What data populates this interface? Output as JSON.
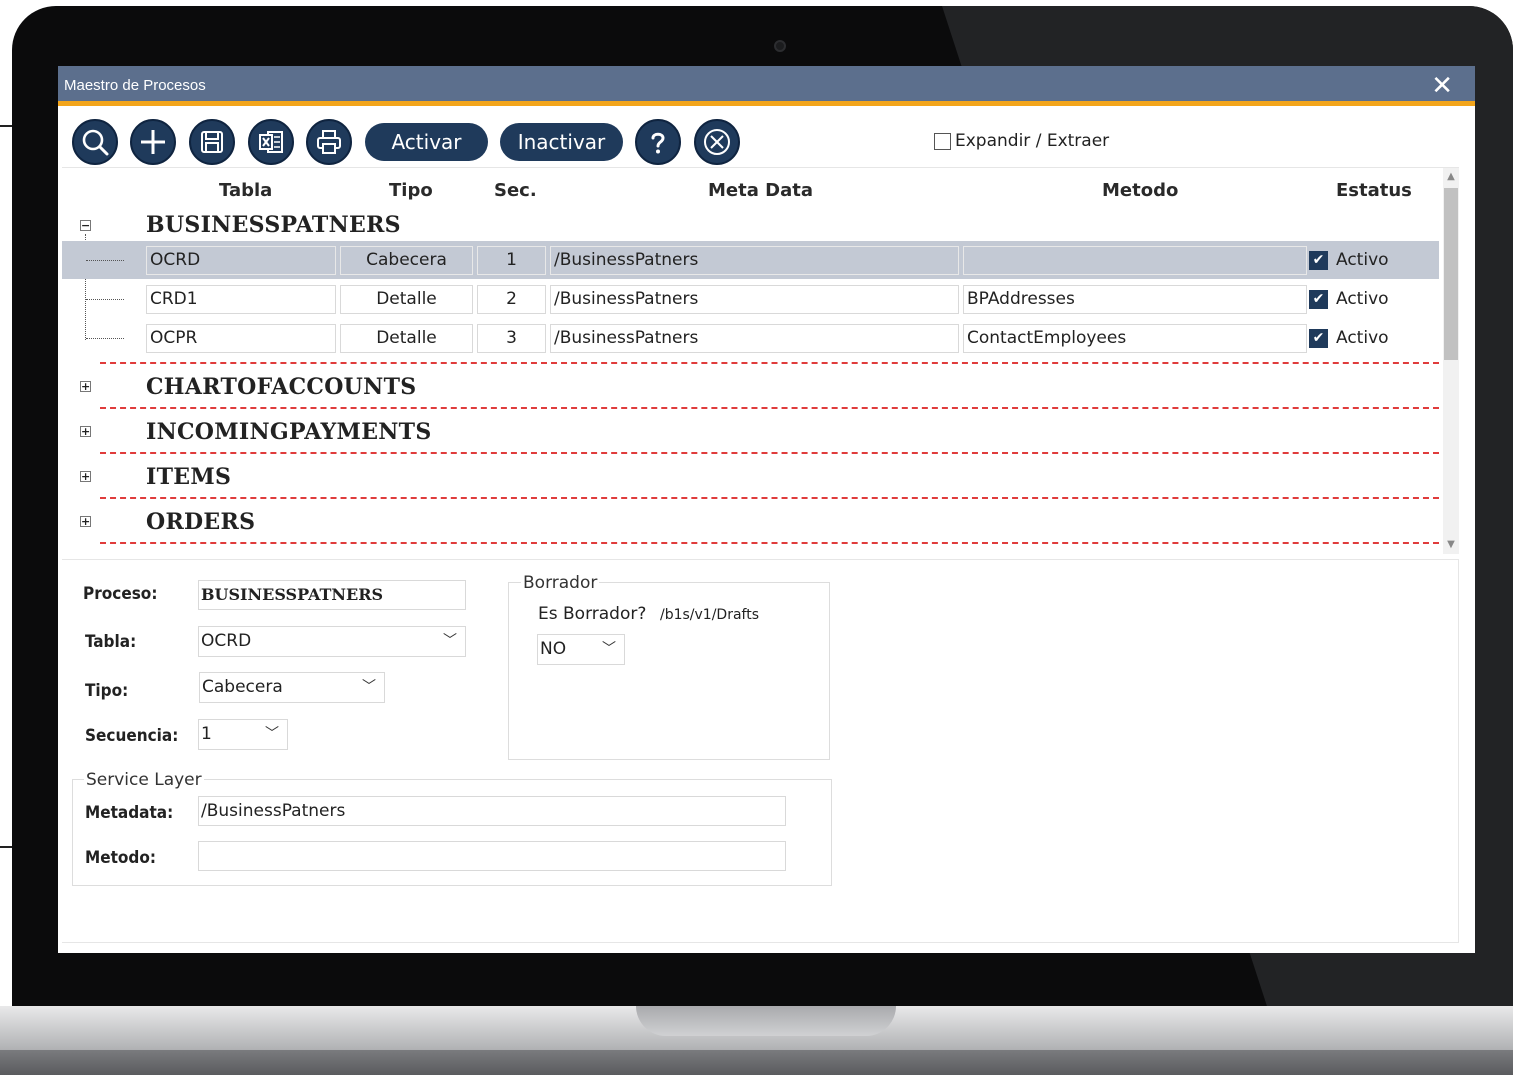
{
  "window": {
    "title": "Maestro de Procesos",
    "close_glyph": "✕"
  },
  "toolbar": {
    "search_icon": "search-icon",
    "add_icon": "plus-icon",
    "save_icon": "save-icon",
    "excel_icon": "excel-icon",
    "print_icon": "print-icon",
    "activate_label": "Activar",
    "deactivate_label": "Inactivar",
    "help_icon": "question-icon",
    "cancel_icon": "close-icon",
    "expand_label": "Expandir / Extraer"
  },
  "grid": {
    "headers": {
      "tabla": "Tabla",
      "tipo": "Tipo",
      "sec": "Sec.",
      "meta": "Meta Data",
      "metodo": "Metodo",
      "estatus": "Estatus"
    },
    "groups": [
      {
        "name": "BUSINESSPATNERS",
        "expanded": true,
        "toggle": "−"
      },
      {
        "name": "CHARTOFACCOUNTS",
        "expanded": false,
        "toggle": "+"
      },
      {
        "name": "INCOMINGPAYMENTS",
        "expanded": false,
        "toggle": "+"
      },
      {
        "name": "ITEMS",
        "expanded": false,
        "toggle": "+"
      },
      {
        "name": "ORDERS",
        "expanded": false,
        "toggle": "+"
      }
    ],
    "rows": [
      {
        "tabla": "OCRD",
        "tipo": "Cabecera",
        "sec": "1",
        "meta": "/BusinessPatners",
        "metodo": "",
        "estatus": "Activo",
        "checked": true,
        "selected": true
      },
      {
        "tabla": "CRD1",
        "tipo": "Detalle",
        "sec": "2",
        "meta": "/BusinessPatners",
        "metodo": "BPAddresses",
        "estatus": "Activo",
        "checked": true,
        "selected": false
      },
      {
        "tabla": "OCPR",
        "tipo": "Detalle",
        "sec": "3",
        "meta": "/BusinessPatners",
        "metodo": "ContactEmployees",
        "estatus": "Activo",
        "checked": true,
        "selected": false
      }
    ],
    "check_glyph": "✔"
  },
  "form": {
    "proceso_label": "Proceso:",
    "proceso_value": "BUSINESSPATNERS",
    "tabla_label": "Tabla:",
    "tabla_value": "OCRD",
    "tipo_label": "Tipo:",
    "tipo_value": "Cabecera",
    "secuencia_label": "Secuencia:",
    "secuencia_value": "1",
    "borrador_legend": "Borrador",
    "es_borrador_label": "Es Borrador?",
    "drafts_path": "/b1s/v1/Drafts",
    "es_borrador_value": "NO",
    "service_layer_legend": "Service Layer",
    "metadata_label": "Metadata:",
    "metadata_value": "/BusinessPatners",
    "metodo_label": "Metodo:",
    "metodo_value": "",
    "chevron": "﹀"
  },
  "colors": {
    "titlebar": "#5c6f8d",
    "accent": "#f3a51b",
    "button": "#1f3a5b",
    "selected_row": "#c3c9d4",
    "group_divider": "#e03c3c"
  }
}
